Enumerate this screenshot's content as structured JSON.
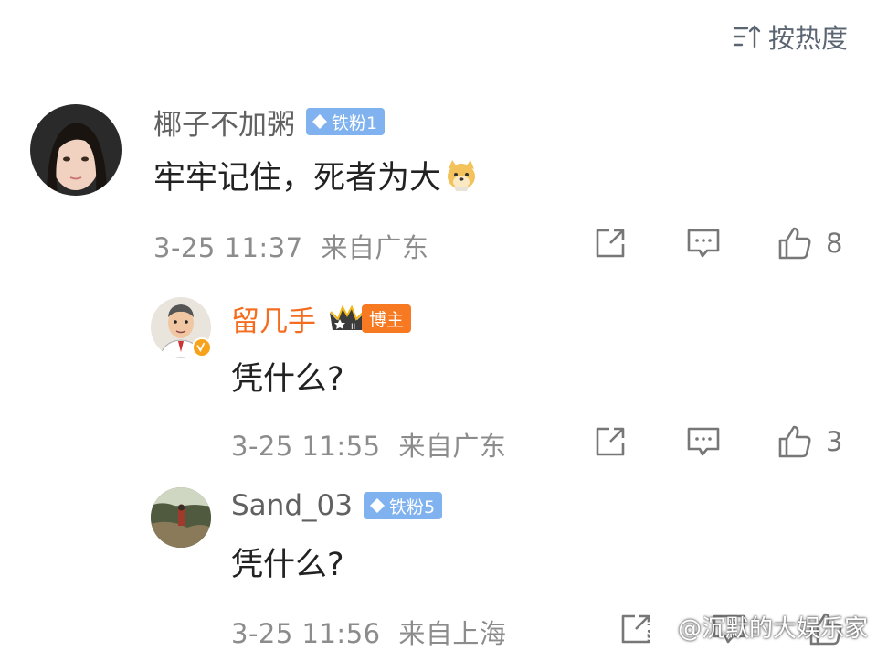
{
  "sort": {
    "label": "按热度",
    "icon": "sort-icon"
  },
  "comments": [
    {
      "username": "椰子不加粥",
      "badge": "铁粉1",
      "text": "牢牢记住，死者为大",
      "time": "3-25 11:37",
      "location": "来自广东",
      "likes": "8"
    },
    {
      "username": "留几手",
      "badge": "博主",
      "crown_level": "II",
      "text": "凭什么?",
      "time": "3-25 11:55",
      "location": "来自广东",
      "likes": "3"
    },
    {
      "username": "Sand_03",
      "badge": "铁粉5",
      "text": "凭什么?",
      "time": "3-25 11:56",
      "location": "来自上海",
      "likes": ""
    }
  ],
  "watermark": {
    "text": "@沉默的大娱乐家"
  },
  "colors": {
    "host_orange": "#f56c1e",
    "fan_badge_blue": "#7fb2ee",
    "verified_orange": "#f7a21b"
  }
}
